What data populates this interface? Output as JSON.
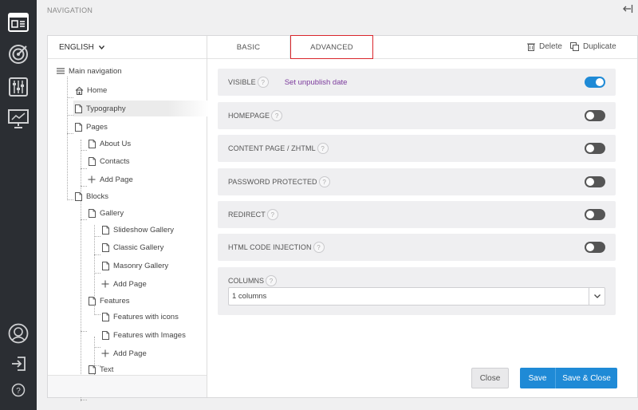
{
  "header": {
    "title": "NAVIGATION"
  },
  "language": {
    "selected": "ENGLISH"
  },
  "tree": {
    "root": "Main navigation",
    "items": [
      {
        "label": "Home",
        "icon": "home-icon"
      },
      {
        "label": "Typography",
        "icon": "page-icon"
      },
      {
        "label": "Pages",
        "icon": "page-icon"
      },
      {
        "label": "About Us",
        "icon": "page-icon"
      },
      {
        "label": "Contacts",
        "icon": "page-icon"
      },
      {
        "label": "Add Page",
        "icon": "plus-icon"
      },
      {
        "label": "Blocks",
        "icon": "page-icon"
      },
      {
        "label": "Gallery",
        "icon": "page-icon"
      },
      {
        "label": "Slideshow Gallery",
        "icon": "page-icon"
      },
      {
        "label": "Classic Gallery",
        "icon": "page-icon"
      },
      {
        "label": "Masonry Gallery",
        "icon": "page-icon"
      },
      {
        "label": "Add Page",
        "icon": "plus-icon"
      },
      {
        "label": "Features",
        "icon": "page-icon"
      },
      {
        "label": "Features with icons",
        "icon": "page-icon"
      },
      {
        "label": "Features with Images",
        "icon": "page-icon"
      },
      {
        "label": "Add Page",
        "icon": "plus-icon"
      },
      {
        "label": "Text",
        "icon": "page-icon"
      }
    ]
  },
  "tabs": {
    "basic": "BASIC",
    "advanced": "ADVANCED"
  },
  "actions": {
    "delete": "Delete",
    "duplicate": "Duplicate"
  },
  "settings": {
    "visible": {
      "label": "VISIBLE",
      "link": "Set unpublish date",
      "on": true
    },
    "homepage": {
      "label": "HOMEPAGE",
      "on": false
    },
    "content_page": {
      "label": "CONTENT PAGE / ZHTML",
      "on": false
    },
    "password": {
      "label": "PASSWORD PROTECTED",
      "on": false
    },
    "redirect": {
      "label": "REDIRECT",
      "on": false
    },
    "html_injection": {
      "label": "HTML CODE INJECTION",
      "on": false
    }
  },
  "help_glyph": "?",
  "columns": {
    "label": "COLUMNS",
    "value": "1 columns"
  },
  "buttons": {
    "close": "Close",
    "save": "Save",
    "save_close": "Save & Close"
  },
  "colors": {
    "accent": "#1f8ad6",
    "rail": "#2b2e33",
    "tab_outline": "#d9262c",
    "link": "#7b3a9c"
  }
}
